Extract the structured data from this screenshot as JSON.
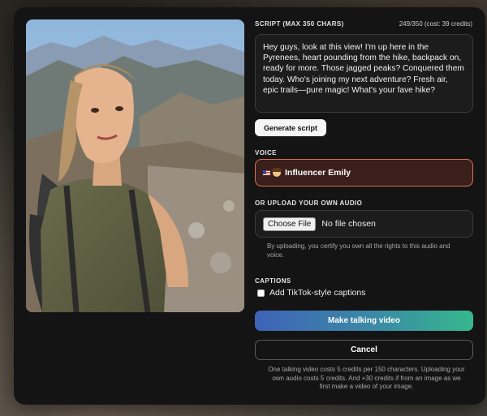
{
  "script": {
    "label": "SCRIPT (MAX 350 CHARS)",
    "counter": "249/350 (cost: 39 credits)",
    "text": "Hey guys, look at this view! I'm up here in the Pyrenees, heart pounding from the hike, backpack on, ready for more. Those jagged peaks? Conquered them today. Who's joining my next adventure? Fresh air, epic trails—pure magic! What's your fave hike?",
    "generate_label": "Generate script"
  },
  "voice": {
    "label": "VOICE",
    "selected": "Influencer Emily",
    "icons": [
      "us-flag-icon",
      "woman-face-icon"
    ]
  },
  "audio": {
    "label": "OR UPLOAD YOUR OWN AUDIO",
    "choose_label": "Choose File",
    "file_status": "No file chosen",
    "disclaimer": "By uploading, you certify you own all the rights to this audio and voice."
  },
  "captions": {
    "label": "CAPTIONS",
    "option": "Add TikTok-style captions",
    "checked": false
  },
  "actions": {
    "make_label": "Make talking video",
    "cancel_label": "Cancel"
  },
  "cost_note": "One talking video costs 5 credits per 150 characters. Uploading your own audio costs 5 credits. And +30 credits if from an image as we first make a video of your image.",
  "colors": {
    "voice_border": "#d9724f",
    "make_gradient_start": "#3e63b8",
    "make_gradient_end": "#36b88e"
  }
}
